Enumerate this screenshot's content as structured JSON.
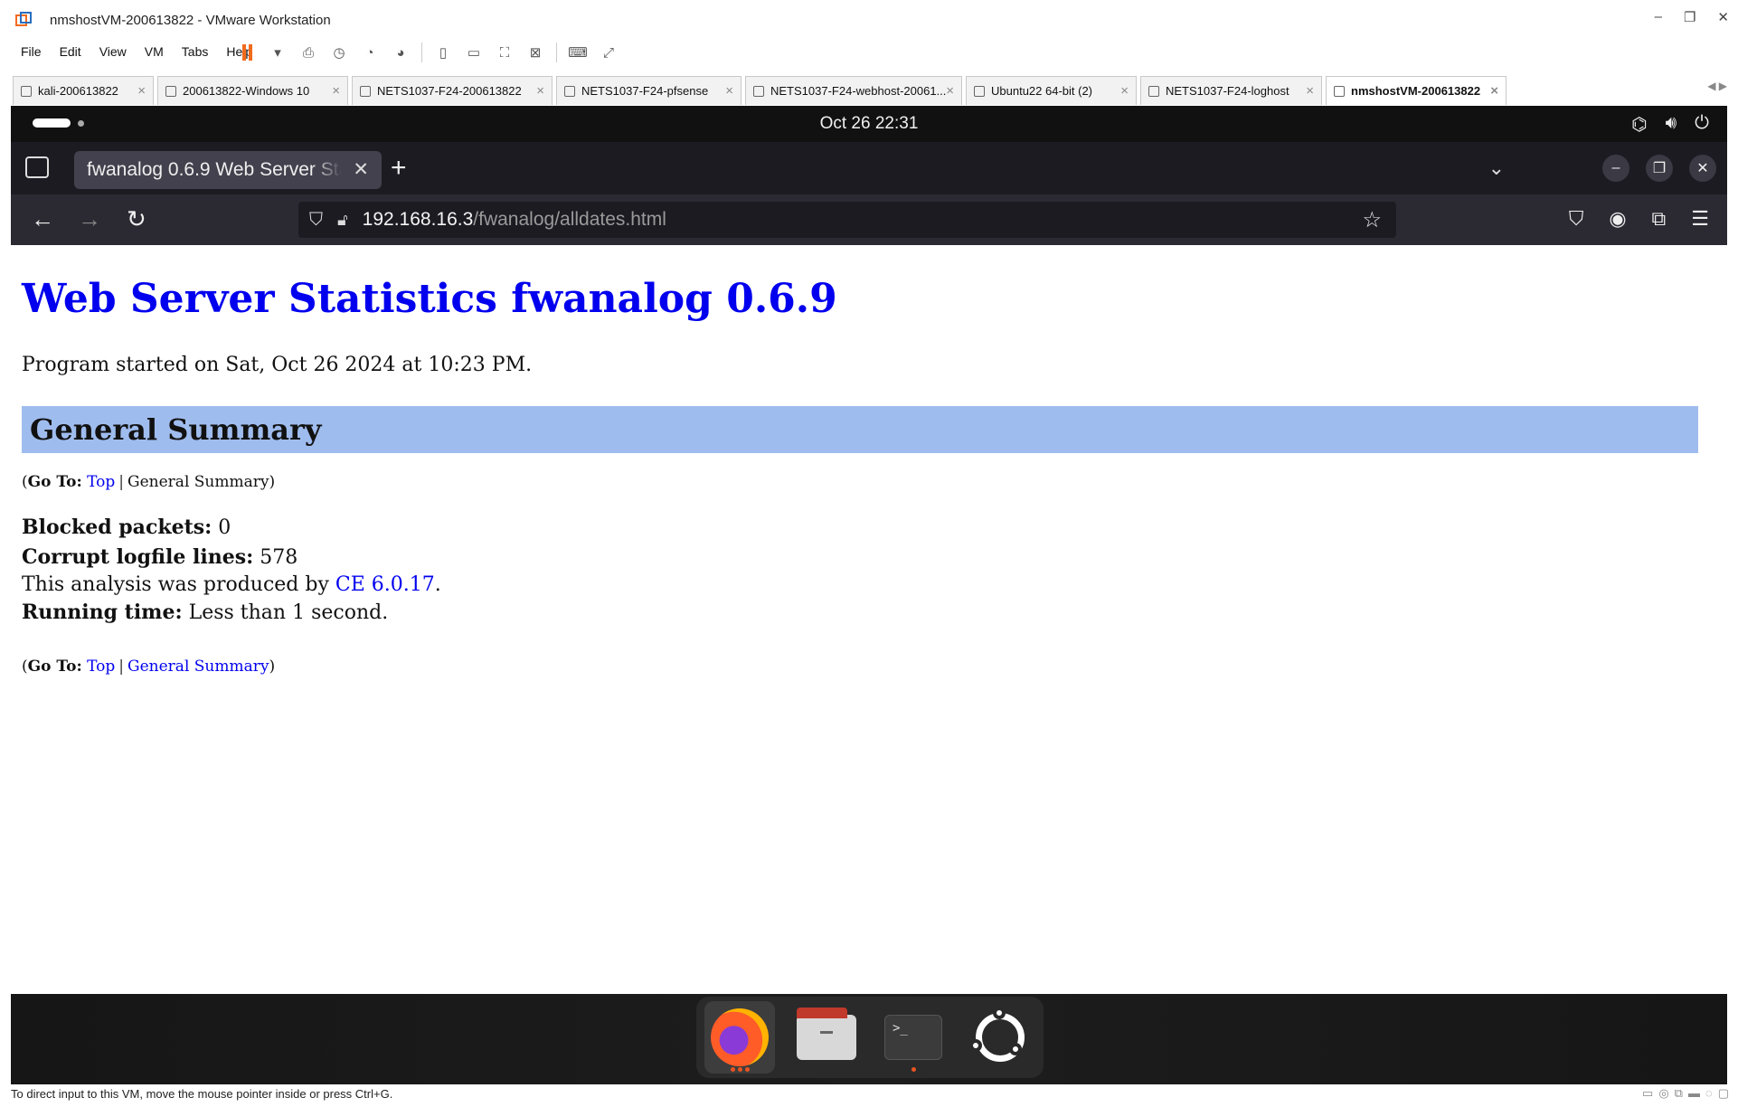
{
  "vm_window": {
    "title": "nmshostVM-200613822 - VMware Workstation",
    "menu": [
      "File",
      "Edit",
      "View",
      "VM",
      "Tabs",
      "Help"
    ],
    "tabs": [
      {
        "label": "kali-200613822",
        "active": false
      },
      {
        "label": "200613822-Windows 10",
        "active": false
      },
      {
        "label": "NETS1037-F24-200613822",
        "active": false
      },
      {
        "label": "NETS1037-F24-pfsense",
        "active": false
      },
      {
        "label": "NETS1037-F24-webhost-20061...",
        "active": false
      },
      {
        "label": "Ubuntu22 64-bit (2)",
        "active": false
      },
      {
        "label": "NETS1037-F24-loghost",
        "active": false
      },
      {
        "label": "nmshostVM-200613822",
        "active": true
      }
    ],
    "status_text": "To direct input to this VM, move the mouse pointer inside or press Ctrl+G.",
    "accent_color": "#f26b1d"
  },
  "gnome": {
    "clock": "Oct 26  22:31"
  },
  "browser": {
    "tab_title": "fwanalog 0.6.9 Web Server Statistics",
    "url_host": "192.168.16.3",
    "url_path": "/fwanalog/alldates.html"
  },
  "page": {
    "title": "Web Server Statistics fwanalog 0.6.9",
    "started": "Program started on Sat, Oct 26 2024 at 10:23 PM.",
    "section_heading": "General Summary",
    "section_color": "#9fbcee",
    "goto_label": "Go To",
    "goto_top": "Top",
    "goto_summary": "General Summary",
    "blocked_label": "Blocked packets:",
    "blocked_value": "0",
    "corrupt_label": "Corrupt logfile lines:",
    "corrupt_value": "578",
    "produced_prefix": "This analysis was produced by",
    "produced_link": "CE 6.0.17",
    "running_label": "Running time:",
    "running_value": "Less than 1 second."
  },
  "dock": {
    "items": [
      "firefox-icon",
      "files-icon",
      "terminal-icon",
      "ubuntu-icon"
    ],
    "terminal_prompt": ">_"
  }
}
